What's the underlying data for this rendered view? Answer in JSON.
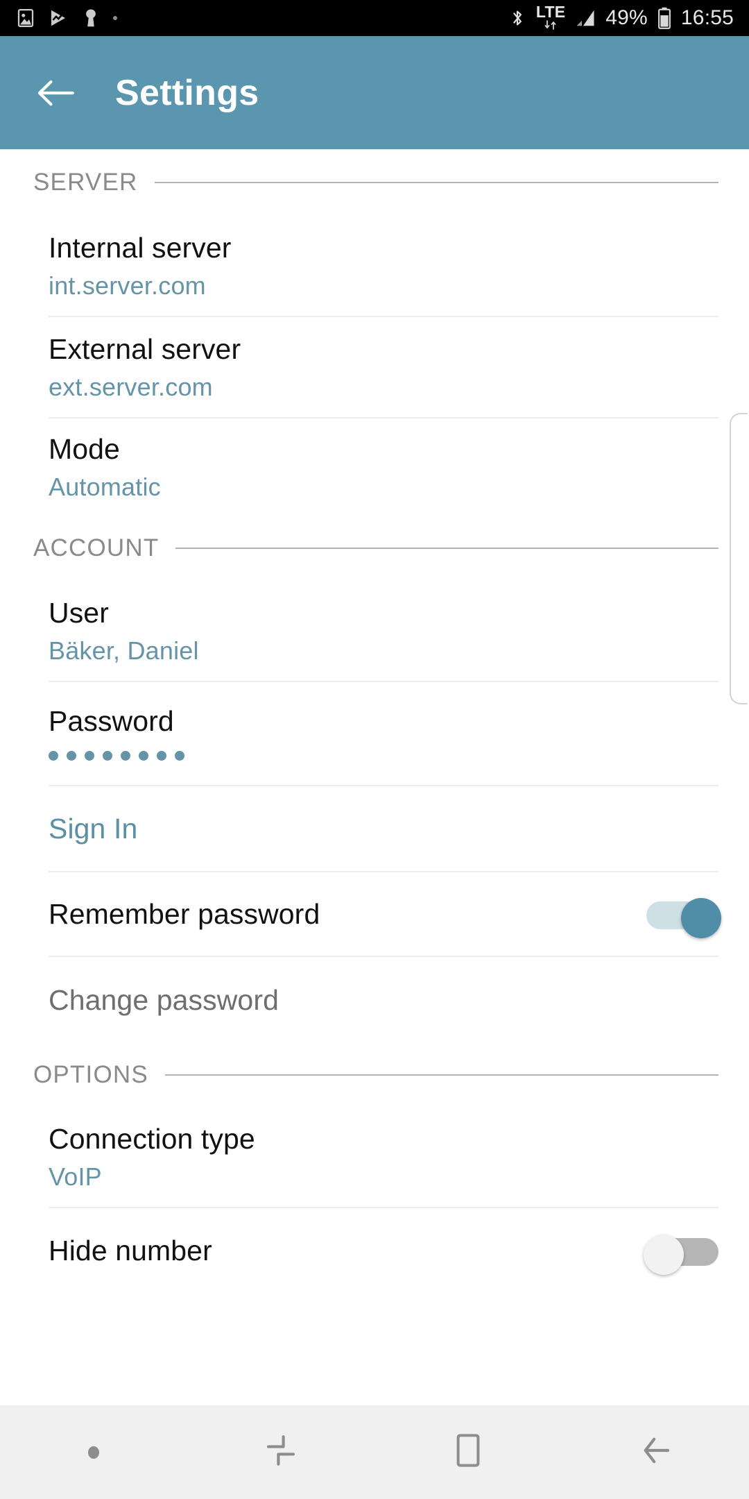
{
  "status_bar": {
    "left_icons": [
      {
        "name": "screenshot-icon",
        "label": "screenshot"
      },
      {
        "name": "media-play-icon",
        "label": "media"
      },
      {
        "name": "vpn-key-icon",
        "label": "vpn"
      },
      {
        "name": "more-dot-icon",
        "label": "more"
      }
    ],
    "right": {
      "bluetooth_icon": "bluetooth-icon",
      "network_type": "LTE",
      "data_arrows_icon": "data-transfer-icon",
      "signal_icon": "signal-bars-icon",
      "battery_percent": "49%",
      "battery_icon": "battery-icon",
      "clock": "16:55"
    }
  },
  "app_bar": {
    "back_label": "back",
    "title": "Settings",
    "background_color": "#5a96ad"
  },
  "colors": {
    "accent": "#5a96ad",
    "value_text": "#6594a8",
    "link": "#5a8fa4",
    "muted": "#6e6e6e",
    "section_header": "#8a8a8a",
    "divider": "#ececed"
  },
  "sections": [
    {
      "id": "server",
      "header": "SERVER",
      "rows": [
        {
          "id": "internal-server",
          "title": "Internal server",
          "value": "int.server.com",
          "type": "value"
        },
        {
          "id": "external-server",
          "title": "External server",
          "value": "ext.server.com",
          "type": "value"
        },
        {
          "id": "mode",
          "title": "Mode",
          "value": "Automatic",
          "type": "value"
        }
      ]
    },
    {
      "id": "account",
      "header": "ACCOUNT",
      "rows": [
        {
          "id": "user",
          "title": "User",
          "value": "Bäker, Daniel",
          "type": "value"
        },
        {
          "id": "password",
          "title": "Password",
          "value": "••••••••",
          "masked_count": 8,
          "type": "password"
        },
        {
          "id": "sign-in",
          "title": "Sign In",
          "type": "link"
        },
        {
          "id": "remember-password",
          "title": "Remember password",
          "type": "toggle",
          "toggle_state": "on"
        },
        {
          "id": "change-password",
          "title": "Change password",
          "type": "disabled"
        }
      ]
    },
    {
      "id": "options",
      "header": "OPTIONS",
      "rows": [
        {
          "id": "connection-type",
          "title": "Connection type",
          "value": "VoIP",
          "type": "value"
        },
        {
          "id": "hide-number",
          "title": "Hide number",
          "type": "toggle",
          "toggle_state": "off"
        }
      ]
    }
  ],
  "nav_bar": {
    "items": [
      {
        "name": "nav-dot",
        "label": "indicator"
      },
      {
        "name": "recents-icon",
        "label": "recents"
      },
      {
        "name": "home-icon",
        "label": "home"
      },
      {
        "name": "back-icon",
        "label": "back"
      }
    ]
  }
}
